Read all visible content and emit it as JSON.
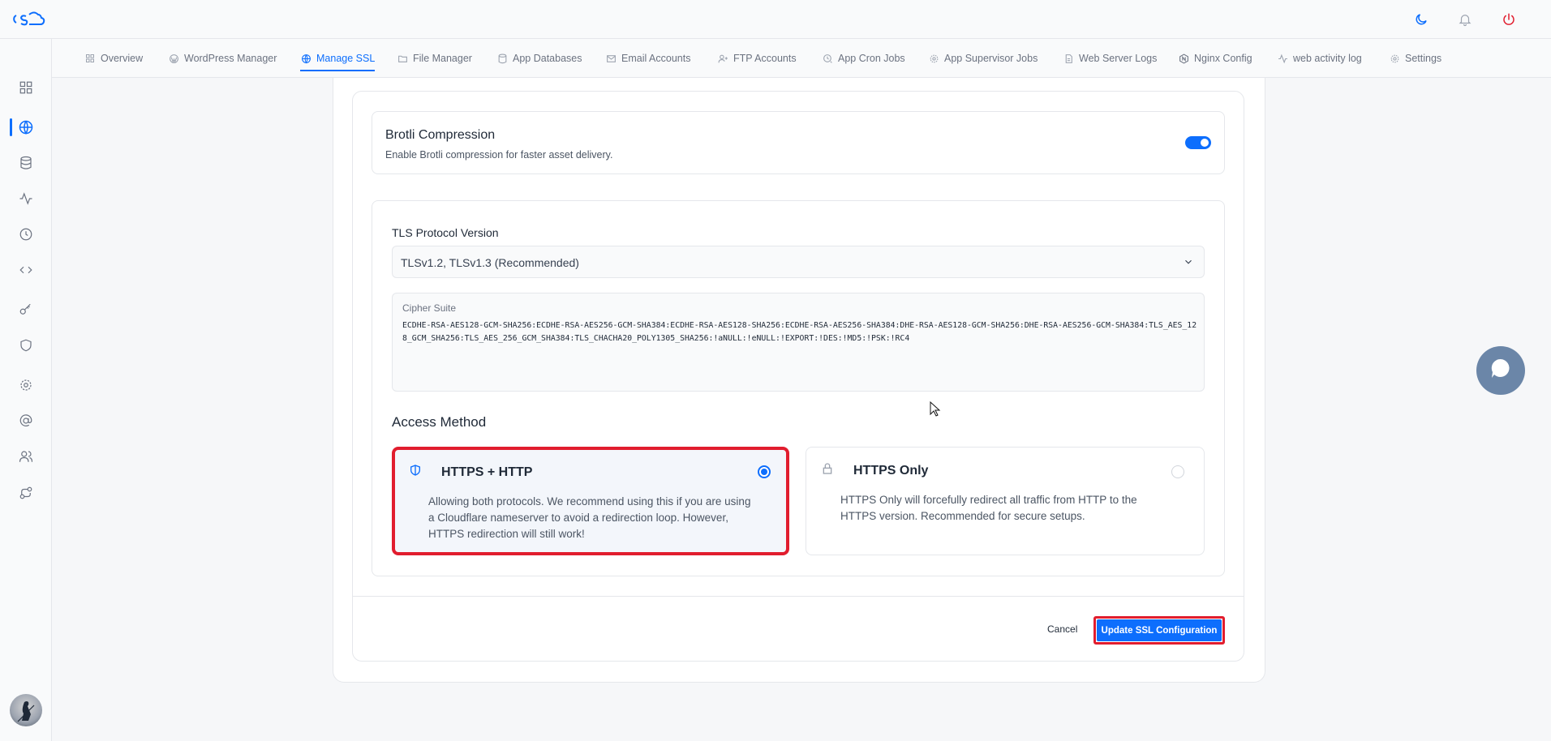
{
  "app": {
    "logo": "cSb",
    "brand_color": "#0d6efd"
  },
  "topbar": {
    "icons": [
      "moon-icon",
      "bell-icon",
      "power-icon"
    ]
  },
  "sidebar": {
    "icons": [
      "dashboard-icon",
      "globe-icon",
      "database-icon",
      "activity-icon",
      "clock-icon",
      "code-icon",
      "key-icon",
      "shield-icon",
      "settings-icon",
      "at-icon",
      "users-icon",
      "route-icon"
    ],
    "active_index": 1
  },
  "tabs": [
    {
      "label": "Overview",
      "icon": "grid-icon"
    },
    {
      "label": "WordPress Manager",
      "icon": "wordpress-icon"
    },
    {
      "label": "Manage SSL",
      "icon": "globe-icon",
      "active": true
    },
    {
      "label": "File Manager",
      "icon": "folder-icon"
    },
    {
      "label": "App Databases",
      "icon": "database-icon"
    },
    {
      "label": "Email Accounts",
      "icon": "mail-icon"
    },
    {
      "label": "FTP Accounts",
      "icon": "user-plus-icon"
    },
    {
      "label": "App Cron Jobs",
      "icon": "cron-icon"
    },
    {
      "label": "App Supervisor Jobs",
      "icon": "supervisor-icon"
    },
    {
      "label": "Web Server Logs",
      "icon": "file-icon"
    },
    {
      "label": "Nginx Config",
      "icon": "nginx-icon"
    },
    {
      "label": "web activity log",
      "icon": "activity-icon"
    },
    {
      "label": "Settings",
      "icon": "gear-icon"
    }
  ],
  "brotli": {
    "title": "Brotli Compression",
    "description": "Enable Brotli compression for faster asset delivery.",
    "enabled": true
  },
  "tls": {
    "label": "TLS Protocol Version",
    "value": "TLSv1.2, TLSv1.3 (Recommended)"
  },
  "cipher": {
    "label": "Cipher Suite",
    "value": "ECDHE-RSA-AES128-GCM-SHA256:ECDHE-RSA-AES256-GCM-SHA384:ECDHE-RSA-AES128-SHA256:ECDHE-RSA-AES256-SHA384:DHE-RSA-AES128-GCM-SHA256:DHE-RSA-AES256-GCM-SHA384:TLS_AES_128_GCM_SHA256:TLS_AES_256_GCM_SHA384:TLS_CHACHA20_POLY1305_SHA256:!aNULL:!eNULL:!EXPORT:!DES:!MD5:!PSK:!RC4"
  },
  "access": {
    "title": "Access Method",
    "options": [
      {
        "title": "HTTPS + HTTP",
        "description": "Allowing both protocols. We recommend using this if you are using a Cloudflare nameserver to avoid a redirection loop. However, HTTPS redirection will still work!",
        "selected": true
      },
      {
        "title": "HTTPS Only",
        "description": "HTTPS Only will forcefully redirect all traffic from HTTP to the HTTPS version. Recommended for secure setups.",
        "selected": false
      }
    ]
  },
  "footer": {
    "cancel_label": "Cancel",
    "submit_label": "Update SSL Configuration"
  }
}
